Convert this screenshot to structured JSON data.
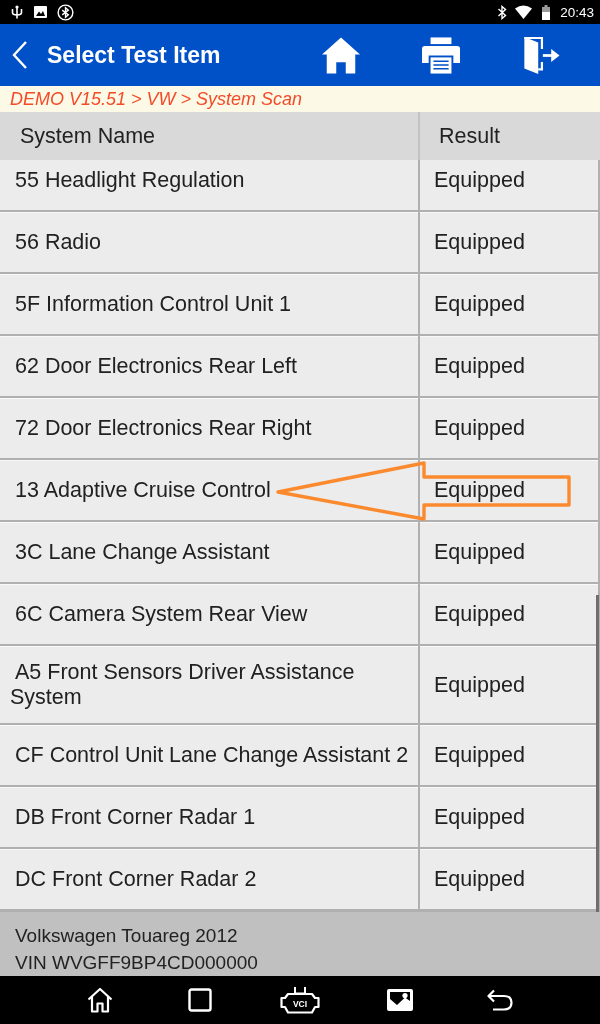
{
  "status_bar": {
    "time": "20:43"
  },
  "header": {
    "title": "Select Test Item"
  },
  "breadcrumb": "DEMO V15.51 > VW > System Scan",
  "table": {
    "columns": [
      "System Name",
      "Result"
    ],
    "rows": [
      {
        "name": "55 Headlight Regulation",
        "result": "Equipped",
        "annotated": false
      },
      {
        "name": "56 Radio",
        "result": "Equipped",
        "annotated": false
      },
      {
        "name": "5F Information Control Unit 1",
        "result": "Equipped",
        "annotated": false
      },
      {
        "name": "62 Door Electronics Rear Left",
        "result": "Equipped",
        "annotated": false
      },
      {
        "name": "72 Door Electronics Rear Right",
        "result": "Equipped",
        "annotated": false
      },
      {
        "name": "13 Adaptive Cruise Control",
        "result": "Equipped",
        "annotated": true
      },
      {
        "name": "3C Lane Change Assistant",
        "result": "Equipped",
        "annotated": false
      },
      {
        "name": "6C Camera System Rear View",
        "result": "Equipped",
        "annotated": false
      },
      {
        "name": "A5 Front Sensors Driver Assistance System",
        "result": "Equipped",
        "annotated": false
      },
      {
        "name": "CF Control Unit Lane Change Assistant 2",
        "result": "Equipped",
        "annotated": false
      },
      {
        "name": "DB Front Corner Radar 1",
        "result": "Equipped",
        "annotated": false
      },
      {
        "name": "DC Front Corner Radar 2",
        "result": "Equipped",
        "annotated": false
      }
    ]
  },
  "vehicle": {
    "model": "Volkswagen Touareg 2012",
    "vin": "VIN WVGFF9BP4CD000000"
  },
  "nav_bar": {
    "vci_label": "VCI"
  }
}
